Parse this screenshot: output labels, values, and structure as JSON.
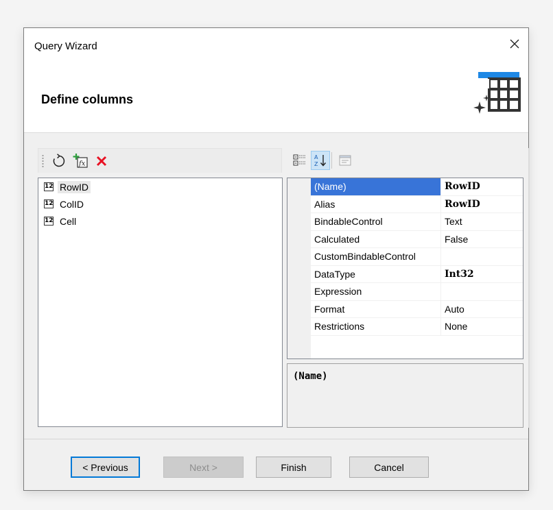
{
  "window": {
    "title": "Query Wizard",
    "step_title": "Define columns"
  },
  "left_toolbar": {
    "icons": [
      "refresh-icon",
      "add-calculated-field-icon",
      "delete-icon"
    ]
  },
  "columns": [
    {
      "type_badge": "12",
      "name": "RowID",
      "selected": true
    },
    {
      "type_badge": "12",
      "name": "ColID",
      "selected": false
    },
    {
      "type_badge": "12",
      "name": "Cell",
      "selected": false
    }
  ],
  "properties_toolbar": {
    "icons": [
      "categorized-icon",
      "alphabetical-sort-icon",
      "property-pages-icon"
    ]
  },
  "properties": [
    {
      "name": "(Name)",
      "value": "RowID"
    },
    {
      "name": "Alias",
      "value": "RowID"
    },
    {
      "name": "BindableControl",
      "value": "Text"
    },
    {
      "name": "Calculated",
      "value": "False"
    },
    {
      "name": "CustomBindableControl",
      "value": ""
    },
    {
      "name": "DataType",
      "value": "Int32"
    },
    {
      "name": "Expression",
      "value": ""
    },
    {
      "name": "Format",
      "value": "Auto"
    },
    {
      "name": "Restrictions",
      "value": "None"
    }
  ],
  "description": {
    "title": "(Name)"
  },
  "buttons": {
    "previous": "< Previous",
    "next": "Next >",
    "finish": "Finish",
    "cancel": "Cancel"
  },
  "colors": {
    "selection": "#3874d8",
    "accent": "#0078d7",
    "header_icon_blue": "#1e88e5",
    "delete_red": "#e81123"
  }
}
